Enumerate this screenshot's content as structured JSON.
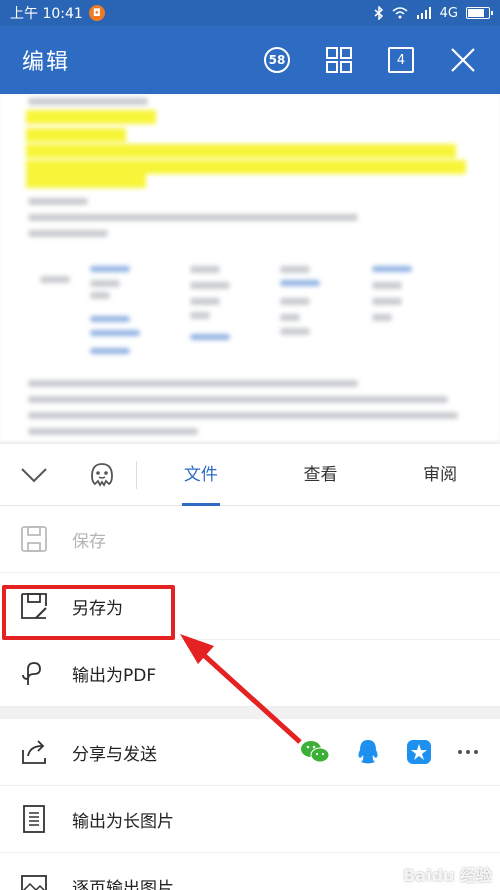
{
  "status_bar": {
    "time": "上午 10:41",
    "notification_badge": "◘",
    "network": "4G"
  },
  "app_bar": {
    "title": "编辑",
    "badge_count": "58",
    "page_count": "4"
  },
  "tabs": [
    {
      "label": "文件",
      "active": true
    },
    {
      "label": "查看",
      "active": false
    },
    {
      "label": "审阅",
      "active": false
    }
  ],
  "menu": {
    "save": "保存",
    "save_as": "另存为",
    "export_pdf": "输出为PDF",
    "share_send": "分享与发送",
    "export_long_image": "输出为长图片",
    "export_page_images": "逐页输出图片"
  },
  "colors": {
    "primary": "#2e6cc4",
    "status": "#2a64b5",
    "highlight": "#e52222"
  },
  "icons": {
    "share_targets": [
      "wechat-icon",
      "qq-icon",
      "star-app-icon",
      "more-icon"
    ]
  },
  "watermark": "Baidu 经验"
}
